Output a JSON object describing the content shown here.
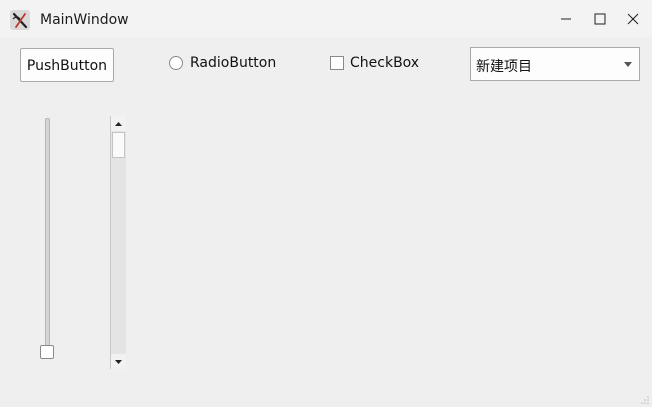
{
  "window": {
    "title": "MainWindow",
    "app_icon": "qt-creator-icon",
    "controls": {
      "minimize": "minimize-icon",
      "maximize": "maximize-icon",
      "close": "close-icon"
    }
  },
  "widgets": {
    "push_button_label": "PushButton",
    "radio_label": "RadioButton",
    "checkbox_label": "CheckBox",
    "combo_value": "新建项目"
  },
  "state": {
    "radio_checked": false,
    "checkbox_checked": false,
    "slider_value_fraction": 0.0,
    "scroll_position_fraction": 0.0
  }
}
